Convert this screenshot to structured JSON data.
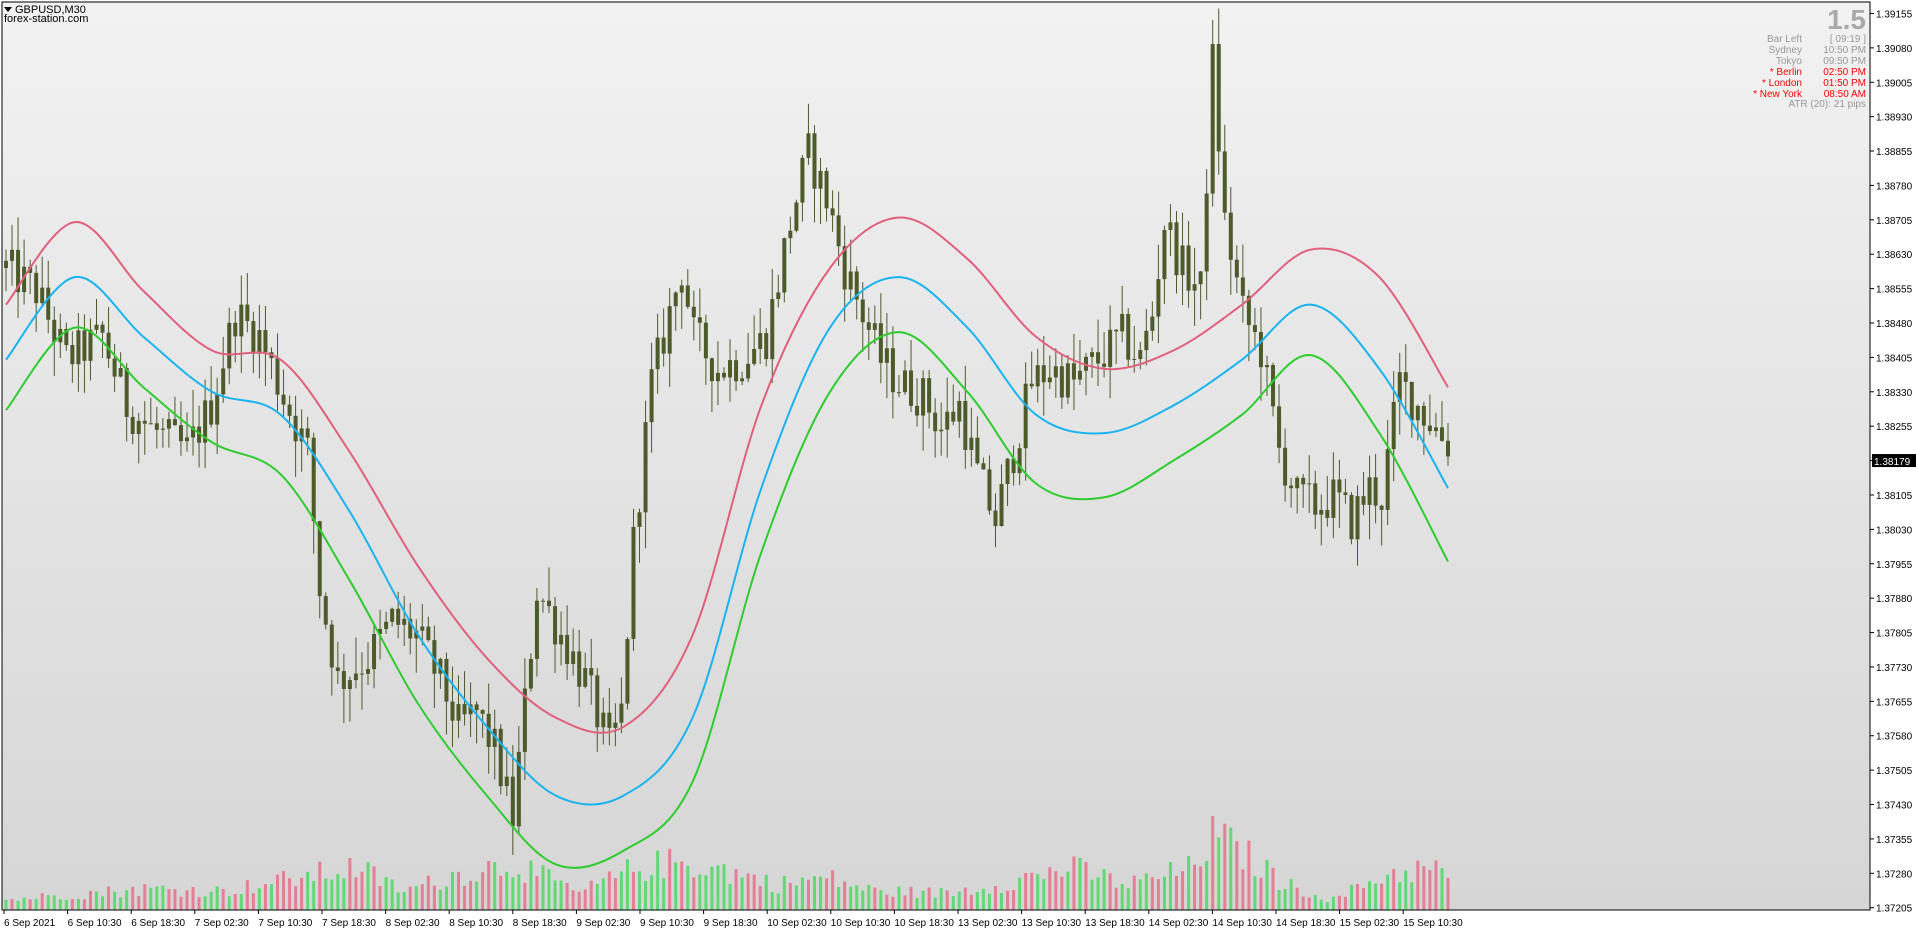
{
  "window": {
    "symbol_title": "GBPUSD,M30",
    "watermark": "forex-station.com",
    "collapse_icon": "triangle-down-icon"
  },
  "hud": {
    "big_value": "1.5",
    "rows": [
      {
        "label": "Bar Left",
        "value": "[ 09:19 ]",
        "color": "#999999"
      },
      {
        "label": "Sydney",
        "value": "10:50 PM",
        "color": "#999999"
      },
      {
        "label": "Tokyo",
        "value": "09:50 PM",
        "color": "#999999"
      },
      {
        "label": "* Berlin",
        "value": "02:50 PM",
        "color": "#ff0000"
      },
      {
        "label": "* London",
        "value": "01:50 PM",
        "color": "#ff0000"
      },
      {
        "label": "* New York",
        "value": "08:50 AM",
        "color": "#ff0000"
      }
    ],
    "atr_text": "ATR (20): 21 pips"
  },
  "colors": {
    "bg_top": "#f2f2f2",
    "bg_bottom": "#d6d6d6",
    "candle": "#4d5a2a",
    "upper_band": "#e0607e",
    "middle_band": "#19b4f0",
    "lower_band": "#2ecc2e",
    "vol_up": "#4cd964",
    "vol_down": "#e7708a",
    "current_price_bg": "#000000",
    "axis_text": "#000000"
  },
  "chart_data": {
    "type": "candlestick",
    "symbol": "GBPUSD",
    "timeframe": "M30",
    "current_price": "1.38179",
    "ylim": [
      1.372,
      1.3918
    ],
    "y_ticks": [
      "1.39155",
      "1.39080",
      "1.39005",
      "1.38930",
      "1.38855",
      "1.38780",
      "1.38705",
      "1.38630",
      "1.38555",
      "1.38480",
      "1.38405",
      "1.38330",
      "1.38255",
      "1.38180",
      "1.38105",
      "1.38030",
      "1.37955",
      "1.37880",
      "1.37805",
      "1.37730",
      "1.37655",
      "1.37580",
      "1.37505",
      "1.37430",
      "1.37355",
      "1.37280",
      "1.37205"
    ],
    "x_ticks": [
      "6 Sep 2021",
      "6 Sep 10:30",
      "6 Sep 18:30",
      "7 Sep 02:30",
      "7 Sep 10:30",
      "7 Sep 18:30",
      "8 Sep 02:30",
      "8 Sep 10:30",
      "8 Sep 18:30",
      "9 Sep 02:30",
      "9 Sep 10:30",
      "9 Sep 18:30",
      "10 Sep 02:30",
      "10 Sep 10:30",
      "10 Sep 18:30",
      "13 Sep 02:30",
      "13 Sep 10:30",
      "13 Sep 18:30",
      "14 Sep 02:30",
      "14 Sep 10:30",
      "14 Sep 18:30",
      "15 Sep 02:30",
      "15 Sep 10:30"
    ],
    "price_path": [
      [
        0,
        1.386
      ],
      [
        5,
        1.3855
      ],
      [
        10,
        1.384
      ],
      [
        16,
        1.3845
      ],
      [
        20,
        1.383
      ],
      [
        24,
        1.3825
      ],
      [
        30,
        1.382
      ],
      [
        34,
        1.383
      ],
      [
        38,
        1.385
      ],
      [
        42,
        1.3845
      ],
      [
        46,
        1.3832
      ],
      [
        50,
        1.382
      ],
      [
        52,
        1.379
      ],
      [
        55,
        1.377
      ],
      [
        60,
        1.3775
      ],
      [
        64,
        1.3783
      ],
      [
        68,
        1.378
      ],
      [
        72,
        1.377
      ],
      [
        75,
        1.376
      ],
      [
        78,
        1.3763
      ],
      [
        81,
        1.3755
      ],
      [
        84,
        1.374
      ],
      [
        86,
        1.3765
      ],
      [
        88,
        1.379
      ],
      [
        92,
        1.378
      ],
      [
        96,
        1.377
      ],
      [
        100,
        1.3755
      ],
      [
        102,
        1.3763
      ],
      [
        104,
        1.38
      ],
      [
        107,
        1.3835
      ],
      [
        110,
        1.385
      ],
      [
        112,
        1.386
      ],
      [
        114,
        1.3845
      ],
      [
        118,
        1.3838
      ],
      [
        122,
        1.384
      ],
      [
        126,
        1.3845
      ],
      [
        130,
        1.387
      ],
      [
        133,
        1.3885
      ],
      [
        136,
        1.3875
      ],
      [
        139,
        1.386
      ],
      [
        142,
        1.385
      ],
      [
        145,
        1.384
      ],
      [
        148,
        1.3835
      ],
      [
        152,
        1.3832
      ],
      [
        155,
        1.3825
      ],
      [
        158,
        1.383
      ],
      [
        161,
        1.3815
      ],
      [
        164,
        1.3805
      ],
      [
        167,
        1.382
      ],
      [
        170,
        1.3835
      ],
      [
        173,
        1.3838
      ],
      [
        177,
        1.3835
      ],
      [
        181,
        1.384
      ],
      [
        185,
        1.3845
      ],
      [
        188,
        1.384
      ],
      [
        190,
        1.385
      ],
      [
        192,
        1.387
      ],
      [
        195,
        1.386
      ],
      [
        198,
        1.3855
      ],
      [
        200,
        1.3905
      ],
      [
        202,
        1.387
      ],
      [
        205,
        1.385
      ],
      [
        208,
        1.3842
      ],
      [
        211,
        1.382
      ],
      [
        214,
        1.381
      ],
      [
        217,
        1.3808
      ],
      [
        220,
        1.381
      ],
      [
        223,
        1.3805
      ],
      [
        226,
        1.3812
      ],
      [
        228,
        1.381
      ],
      [
        231,
        1.3835
      ],
      [
        234,
        1.383
      ],
      [
        237,
        1.3825
      ],
      [
        240,
        1.382
      ]
    ],
    "bands": {
      "upper": [
        1.3852,
        1.387,
        1.3855,
        1.3842,
        1.384,
        1.382,
        1.3795,
        1.3775,
        1.3762,
        1.376,
        1.378,
        1.383,
        1.386,
        1.3871,
        1.3862,
        1.3845,
        1.3838,
        1.3842,
        1.3852,
        1.3864,
        1.3858,
        1.3834
      ],
      "middle": [
        1.384,
        1.3858,
        1.3845,
        1.3833,
        1.3828,
        1.3807,
        1.378,
        1.376,
        1.3745,
        1.3745,
        1.3762,
        1.3812,
        1.3847,
        1.3858,
        1.3847,
        1.3828,
        1.3824,
        1.383,
        1.384,
        1.3852,
        1.3838,
        1.3812
      ],
      "lower": [
        1.3829,
        1.3847,
        1.3834,
        1.3822,
        1.3815,
        1.3792,
        1.3765,
        1.3745,
        1.373,
        1.3733,
        1.3748,
        1.3798,
        1.3833,
        1.3846,
        1.3833,
        1.3813,
        1.381,
        1.3818,
        1.3828,
        1.3841,
        1.3824,
        1.3796
      ]
    },
    "volume_peaks": [
      [
        0,
        12
      ],
      [
        10,
        18
      ],
      [
        24,
        25
      ],
      [
        36,
        22
      ],
      [
        50,
        40
      ],
      [
        58,
        50
      ],
      [
        66,
        22
      ],
      [
        74,
        40
      ],
      [
        84,
        55
      ],
      [
        95,
        20
      ],
      [
        104,
        48
      ],
      [
        110,
        55
      ],
      [
        116,
        52
      ],
      [
        128,
        30
      ],
      [
        136,
        38
      ],
      [
        144,
        22
      ],
      [
        156,
        20
      ],
      [
        166,
        32
      ],
      [
        176,
        50
      ],
      [
        186,
        30
      ],
      [
        196,
        48
      ],
      [
        200,
        85
      ],
      [
        204,
        72
      ],
      [
        212,
        30
      ],
      [
        220,
        12
      ],
      [
        228,
        40
      ],
      [
        234,
        48
      ],
      [
        238,
        45
      ]
    ]
  }
}
